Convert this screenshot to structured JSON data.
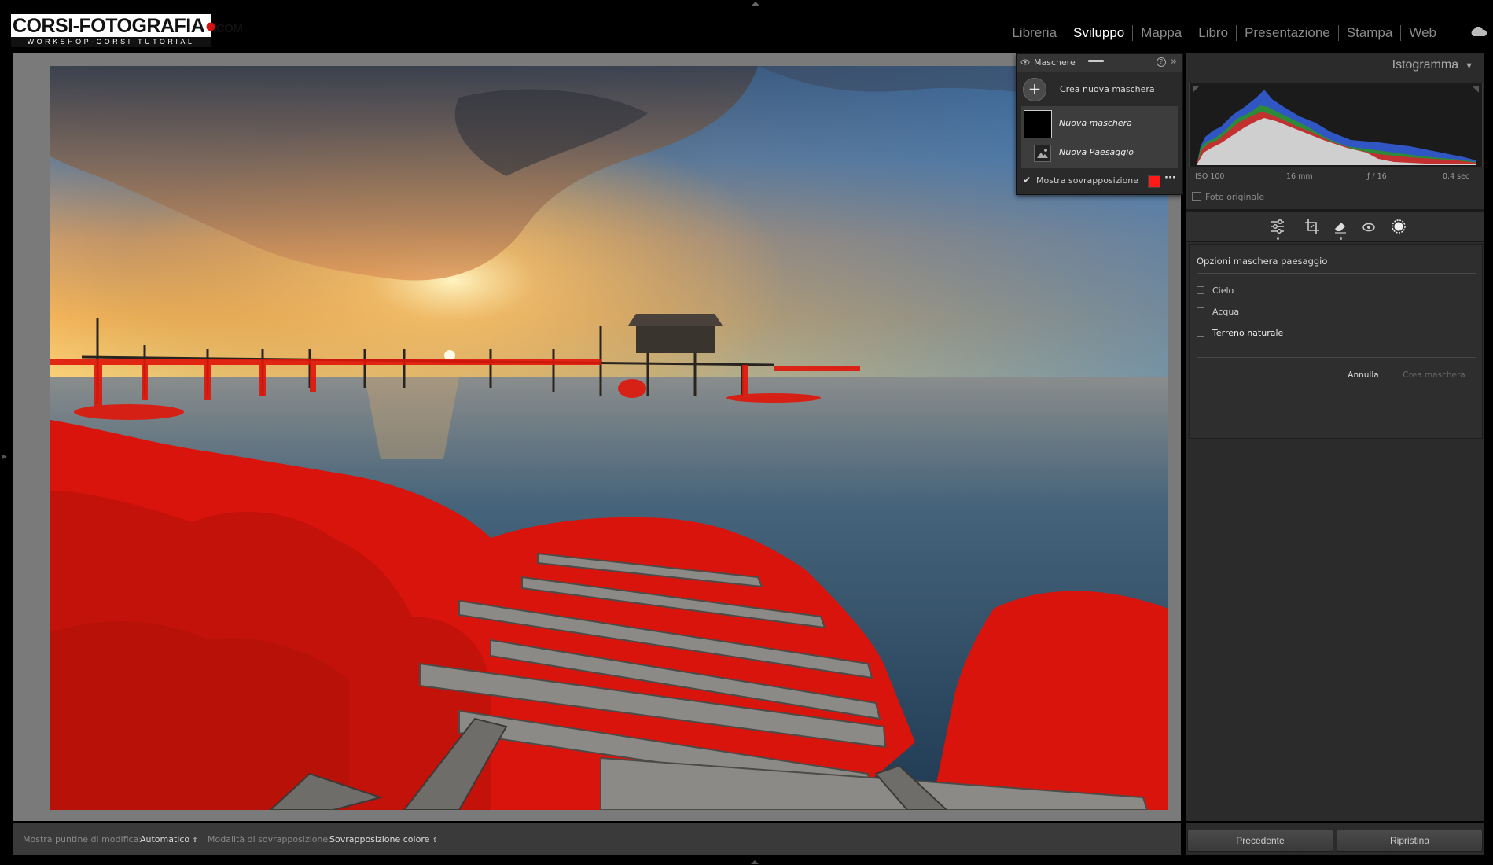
{
  "logo": {
    "main": "CORSI-FOTOGRAFIA",
    "dot": "●",
    "suffix": "COM",
    "tagline": "WORKSHOP-CORSI-TUTORIAL"
  },
  "modules": [
    "Libreria",
    "Sviluppo",
    "Mappa",
    "Libro",
    "Presentazione",
    "Stampa",
    "Web"
  ],
  "active_module": "Sviluppo",
  "masks_panel": {
    "title": "Maschere",
    "create_label": "Crea nuova maschera",
    "masks": [
      {
        "label": "Nuova maschera"
      },
      {
        "label": "Nuova Paesaggio"
      }
    ],
    "overlay_label": "Mostra sovrapposizione",
    "overlay_color": "#ff1a1a"
  },
  "histogram": {
    "title": "Istogramma",
    "iso": "ISO 100",
    "focal": "16 mm",
    "aperture": "ƒ / 16",
    "shutter": "0.4 sec",
    "original_photo_label": "Foto originale"
  },
  "tools": [
    "sliders-icon",
    "crop-icon",
    "eraser-icon",
    "red-eye-icon",
    "mask-icon"
  ],
  "landscape_mask": {
    "title": "Opzioni maschera paesaggio",
    "options": [
      {
        "label": "Cielo",
        "checked": false
      },
      {
        "label": "Acqua",
        "checked": false
      },
      {
        "label": "Terreno naturale",
        "checked": false
      }
    ],
    "cancel_label": "Annulla",
    "create_label": "Crea maschera"
  },
  "bottom_toolbar": {
    "show_pins_label": "Mostra puntine di modifica:",
    "show_pins_value": "Automatico",
    "overlay_mode_label": "Modalità di sovrapposizione:",
    "overlay_mode_value": "Sovrapposizione colore"
  },
  "buttons": {
    "previous": "Precedente",
    "reset": "Ripristina"
  }
}
